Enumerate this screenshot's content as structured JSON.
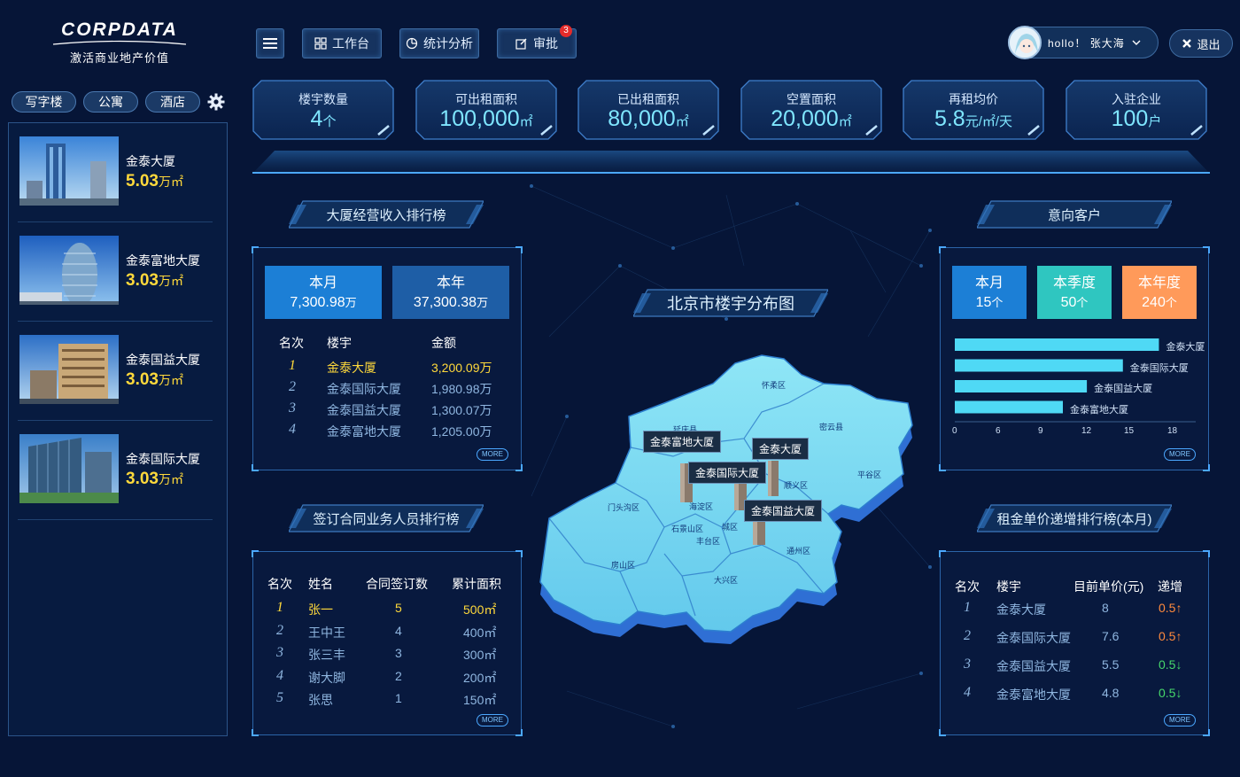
{
  "brand": {
    "name": "CORPDATA",
    "slogan": "激活商业地产价值"
  },
  "nav": {
    "menu_icon": "menu-icon",
    "workbench": "工作台",
    "stats": "统计分析",
    "approval": "审批",
    "approval_badge": "3"
  },
  "user": {
    "greeting": "hollo！ 张大海",
    "logout": "退出"
  },
  "categories": [
    "写字楼",
    "公寓",
    "酒店"
  ],
  "buildings": [
    {
      "name": "金泰大厦",
      "area": "5.03",
      "unit": "万㎡"
    },
    {
      "name": "金泰富地大厦",
      "area": "3.03",
      "unit": "万㎡"
    },
    {
      "name": "金泰国益大厦",
      "area": "3.03",
      "unit": "万㎡"
    },
    {
      "name": "金泰国际大厦",
      "area": "3.03",
      "unit": "万㎡"
    }
  ],
  "stats": [
    {
      "label": "楼宇数量",
      "value": "4",
      "unit": "个"
    },
    {
      "label": "可出租面积",
      "value": "100,000",
      "unit": "㎡"
    },
    {
      "label": "已出租面积",
      "value": "80,000",
      "unit": "㎡"
    },
    {
      "label": "空置面积",
      "value": "20,000",
      "unit": "㎡"
    },
    {
      "label": "再租均价",
      "value": "5.8",
      "unit": "元/㎡/天"
    },
    {
      "label": "入驻企业",
      "value": "100",
      "unit": "户"
    }
  ],
  "revenue": {
    "title": "大厦经营收入排行榜",
    "tabs": [
      {
        "label": "本月",
        "value": "7,300.98",
        "unit": "万"
      },
      {
        "label": "本年",
        "value": "37,300.38",
        "unit": "万"
      }
    ],
    "headers": [
      "名次",
      "楼宇",
      "金额"
    ],
    "rows": [
      {
        "rank": "1",
        "name": "金泰大厦",
        "amount": "3,200.09万"
      },
      {
        "rank": "2",
        "name": "金泰国际大厦",
        "amount": "1,980.98万"
      },
      {
        "rank": "3",
        "name": "金泰国益大厦",
        "amount": "1,300.07万"
      },
      {
        "rank": "4",
        "name": "金泰富地大厦",
        "amount": "1,205.00万"
      }
    ],
    "more": "MORE"
  },
  "contracts": {
    "title": "签订合同业务人员排行榜",
    "headers": [
      "名次",
      "姓名",
      "合同签订数",
      "累计面积"
    ],
    "rows": [
      {
        "rank": "1",
        "name": "张一",
        "count": "5",
        "area": "500㎡"
      },
      {
        "rank": "2",
        "name": "王中王",
        "count": "4",
        "area": "400㎡"
      },
      {
        "rank": "3",
        "name": "张三丰",
        "count": "3",
        "area": "300㎡"
      },
      {
        "rank": "4",
        "name": "谢大脚",
        "count": "2",
        "area": "200㎡"
      },
      {
        "rank": "5",
        "name": "张思",
        "count": "1",
        "area": "150㎡"
      }
    ],
    "more": "MORE"
  },
  "map": {
    "title": "北京市楼宇分布图",
    "districts": [
      "怀柔区",
      "延庆县",
      "密云县",
      "平谷区",
      "顺义区",
      "门头沟区",
      "海淀区",
      "石景山区",
      "城区",
      "丰台区",
      "房山区",
      "大兴区",
      "通州区"
    ],
    "markers": [
      "金泰富地大厦",
      "金泰大厦",
      "金泰国际大厦",
      "金泰国益大厦"
    ]
  },
  "customers": {
    "title": "意向客户",
    "tabs": [
      {
        "label": "本月",
        "value": "15",
        "unit": "个"
      },
      {
        "label": "本季度",
        "value": "50",
        "unit": "个"
      },
      {
        "label": "本年度",
        "value": "240",
        "unit": "个"
      }
    ],
    "more": "MORE"
  },
  "chart_data": {
    "type": "bar",
    "orientation": "horizontal",
    "categories": [
      "金泰大厦",
      "金泰国际大厦",
      "金泰国益大厦",
      "金泰富地大厦"
    ],
    "values": [
      17,
      14,
      11,
      9
    ],
    "xticks": [
      "0",
      "6",
      "9",
      "12",
      "15",
      "18"
    ],
    "xlim": [
      0,
      18
    ],
    "color": "#4fd9f5"
  },
  "rent": {
    "title": "租金单价递增排行榜(本月)",
    "headers": [
      "名次",
      "楼宇",
      "目前单价(元)",
      "递增"
    ],
    "rows": [
      {
        "rank": "1",
        "name": "金泰大厦",
        "price": "8",
        "change": "0.5↑",
        "dir": "up"
      },
      {
        "rank": "2",
        "name": "金泰国际大厦",
        "price": "7.6",
        "change": "0.5↑",
        "dir": "up"
      },
      {
        "rank": "3",
        "name": "金泰国益大厦",
        "price": "5.5",
        "change": "0.5↓",
        "dir": "down"
      },
      {
        "rank": "4",
        "name": "金泰富地大厦",
        "price": "4.8",
        "change": "0.5↓",
        "dir": "down"
      }
    ],
    "more": "MORE"
  },
  "colors": {
    "accent": "#4ba8ff",
    "gold": "#ffd93b",
    "up": "#ff8a3d",
    "down": "#46d86b",
    "tab_blue": "#1c7fd6",
    "tab_teal": "#2fc6c0",
    "tab_orange": "#ff9a5a"
  }
}
